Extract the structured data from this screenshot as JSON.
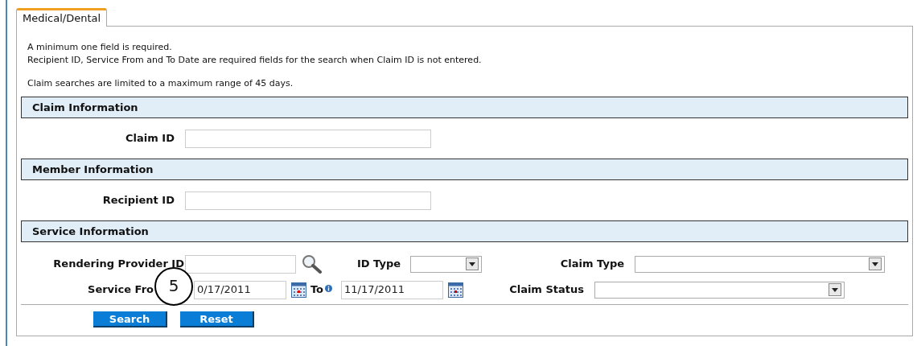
{
  "tabs": [
    {
      "label": "Medical/Dental",
      "selected": true
    }
  ],
  "note_groups": [
    [
      "A minimum one field is required.",
      "Recipient ID, Service From and To Date are required fields for the search when Claim ID is not entered."
    ],
    [
      "Claim searches are limited to a maximum range of 45 days."
    ]
  ],
  "claim_information": {
    "title": "Claim Information",
    "fields": [
      {
        "label": "Claim ID"
      }
    ]
  },
  "member_information": {
    "title": "Member Information",
    "fields": [
      {
        "label": "Recipient ID"
      }
    ]
  },
  "service_information": {
    "title": "Service Information",
    "rows": [
      [
        {
          "kind": "lookup",
          "label": "Rendering Provider ID"
        },
        {
          "kind": "select",
          "label": "ID Type"
        },
        {
          "kind": "wide-select",
          "label": "Claim Type"
        }
      ],
      [
        {
          "kind": "date",
          "label": "Service Fro",
          "value": "0/17/2011"
        },
        {
          "kind": "date",
          "label": "To",
          "info": true,
          "value": "11/17/2011"
        },
        {
          "kind": "wide-select",
          "label": "Claim Status"
        }
      ]
    ]
  },
  "buttons": [
    "Search",
    "Reset"
  ],
  "callout": {
    "label": "5"
  }
}
